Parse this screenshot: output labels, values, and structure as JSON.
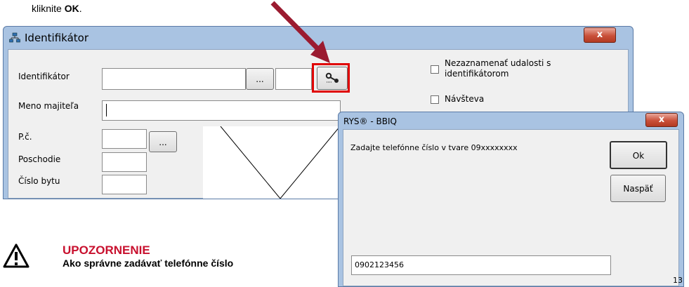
{
  "caption": {
    "text": "kliknite ",
    "bold": "OK",
    "end": "."
  },
  "main_window": {
    "title": "Identifikátor",
    "close_label": "x",
    "fields": {
      "identifikator_label": "Identifikátor",
      "meno_label": "Meno majiteľa",
      "pc_label": "P.č.",
      "poschodie_label": "Poschodie",
      "cislo_bytu_label": "Číslo bytu",
      "browse_label": "...",
      "pc_browse_label": "..."
    },
    "checkboxes": {
      "nezaznamenat_label_line1": "Nezaznamenať udalosti s",
      "nezaznamenat_label_line2": "identifikátorom",
      "navsteva_label": "Návšteva"
    }
  },
  "dialog": {
    "title": "RYS® - BBIQ",
    "close_label": "x",
    "prompt": "Zadajte telefónne číslo v tvare 09xxxxxxxx",
    "ok_label": "Ok",
    "back_label": "Naspäť",
    "input_value": "0902123456",
    "corner_number": "13"
  },
  "warning": {
    "title": "UPOZORNENIE",
    "subtitle": "Ako správne zadávať telefónne číslo"
  },
  "colors": {
    "arrow": "#9b1b30",
    "highlight": "#e00000",
    "warning_title": "#c8102e"
  }
}
